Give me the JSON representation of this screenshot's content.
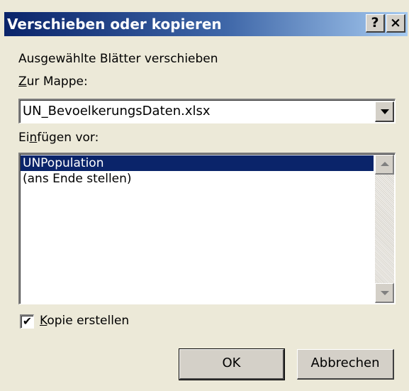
{
  "window": {
    "title": "Verschieben oder kopieren",
    "help_button": "?",
    "close_button": "×"
  },
  "heading": "Ausgewählte Blätter verschieben",
  "workbook": {
    "label_mnemonic": "Z",
    "label_rest": "ur Mappe:",
    "selected_value": "UN_BevoelkerungsDaten.xlsx"
  },
  "insert_before": {
    "label_pre": "Ei",
    "label_mnemonic": "n",
    "label_post": "fügen vor:",
    "items": [
      {
        "label": "UNPopulation",
        "selected": true
      },
      {
        "label": "(ans Ende stellen)",
        "selected": false
      }
    ]
  },
  "copy": {
    "checked": true,
    "check_mark": "✔",
    "label_mnemonic": "K",
    "label_rest": "opie erstellen"
  },
  "buttons": {
    "ok": "OK",
    "cancel": "Abbrechen"
  },
  "colors": {
    "title_bar_start": "#0a246a",
    "title_bar_end": "#a6caf0",
    "dialog_face": "#ece9d8",
    "selection": "#0a246a"
  }
}
